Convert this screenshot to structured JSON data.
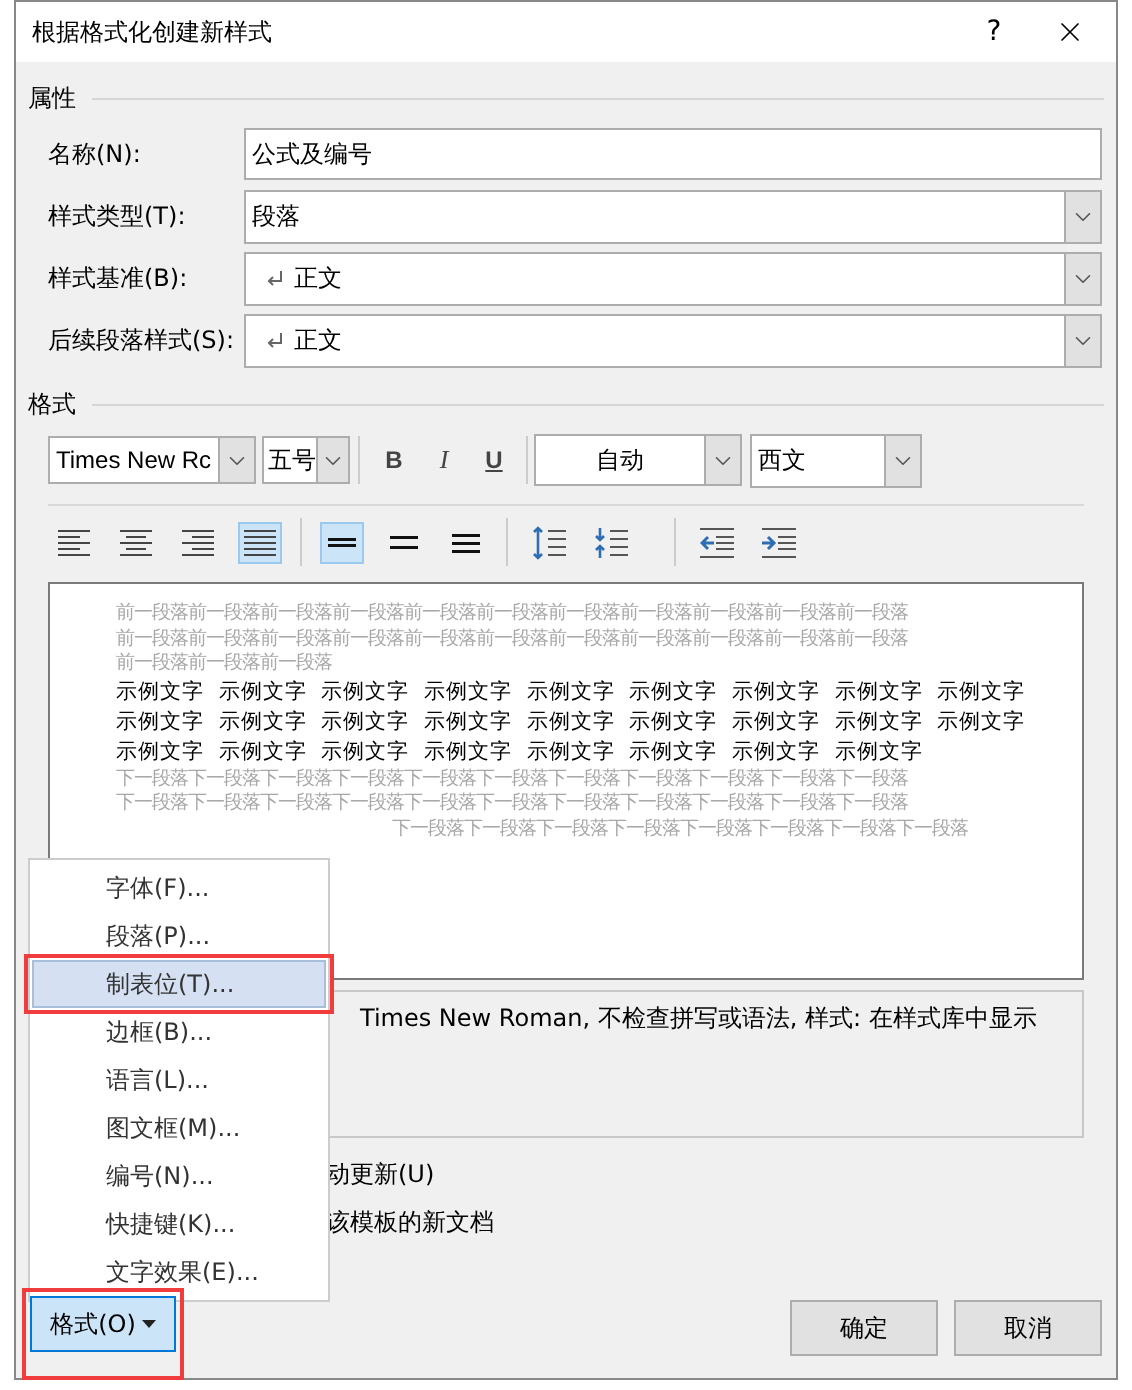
{
  "window": {
    "title": "根据格式化创建新样式",
    "help": "?"
  },
  "properties": {
    "heading": "属性",
    "fields": [
      {
        "label": "名称(N):",
        "value": "公式及编号",
        "kind": "text"
      },
      {
        "label": "样式类型(T):",
        "value": "段落",
        "kind": "dropdown"
      },
      {
        "label": "样式基准(B):",
        "value": "正文",
        "kind": "style"
      },
      {
        "label": "后续段落样式(S):",
        "value": "正文",
        "kind": "style"
      }
    ]
  },
  "format": {
    "heading": "格式",
    "font": "Times New Rc",
    "size": "五号",
    "bold": "B",
    "italic": "I",
    "underline": "U",
    "color_name": "自动",
    "script": "西文",
    "alignment": [
      {
        "kind": "left",
        "selected": false
      },
      {
        "kind": "center",
        "selected": false
      },
      {
        "kind": "right",
        "selected": false
      },
      {
        "kind": "justify",
        "selected": true
      }
    ],
    "line_spacing": [
      {
        "kind": "single",
        "selected": true
      },
      {
        "kind": "one_half",
        "selected": false
      },
      {
        "kind": "double",
        "selected": false
      }
    ],
    "paragraph_spacing": [
      {
        "kind": "increase"
      },
      {
        "kind": "decrease"
      }
    ],
    "indent": [
      {
        "kind": "decrease"
      },
      {
        "kind": "increase"
      }
    ]
  },
  "preview": {
    "previous": [
      "前一段落前一段落前一段落前一段落前一段落前一段落前一段落前一段落前一段落前一段落前一段落",
      "前一段落前一段落前一段落前一段落前一段落前一段落前一段落前一段落前一段落前一段落前一段落",
      "前一段落前一段落前一段落"
    ],
    "sample": [
      "示例文字 示例文字 示例文字 示例文字 示例文字 示例文字 示例文字 示例文字 示例文字",
      "示例文字 示例文字 示例文字 示例文字 示例文字 示例文字 示例文字 示例文字 示例文字",
      "示例文字 示例文字 示例文字 示例文字 示例文字 示例文字 示例文字 示例文字"
    ],
    "next": [
      "下一段落下一段落下一段落下一段落下一段落下一段落下一段落下一段落下一段落下一段落下一段落",
      "下一段落下一段落下一段落下一段落下一段落下一段落下一段落下一段落下一段落下一段落下一段落",
      "下一段落下一段落下一段落下一段落下一段落下一段落下一段落下一段落"
    ]
  },
  "description": "Times New Roman, 不检查拼写或语法, 样式: 在样式库中显示",
  "options": [
    "动更新(U)",
    "该模板的新文档"
  ],
  "menu": [
    {
      "label": "字体(F)...",
      "selected": false,
      "annotated": false
    },
    {
      "label": "段落(P)...",
      "selected": false,
      "annotated": false
    },
    {
      "label": "制表位(T)...",
      "selected": true,
      "annotated": true
    },
    {
      "label": "边框(B)...",
      "selected": false,
      "annotated": false
    },
    {
      "label": "语言(L)...",
      "selected": false,
      "annotated": false
    },
    {
      "label": "图文框(M)...",
      "selected": false,
      "annotated": false
    },
    {
      "label": "编号(N)...",
      "selected": false,
      "annotated": false
    },
    {
      "label": "快捷键(K)...",
      "selected": false,
      "annotated": false
    },
    {
      "label": "文字效果(E)...",
      "selected": false,
      "annotated": false
    }
  ],
  "format_button": {
    "label": "格式(O)",
    "annotated": true
  },
  "buttons": [
    "确定",
    "取消"
  ]
}
